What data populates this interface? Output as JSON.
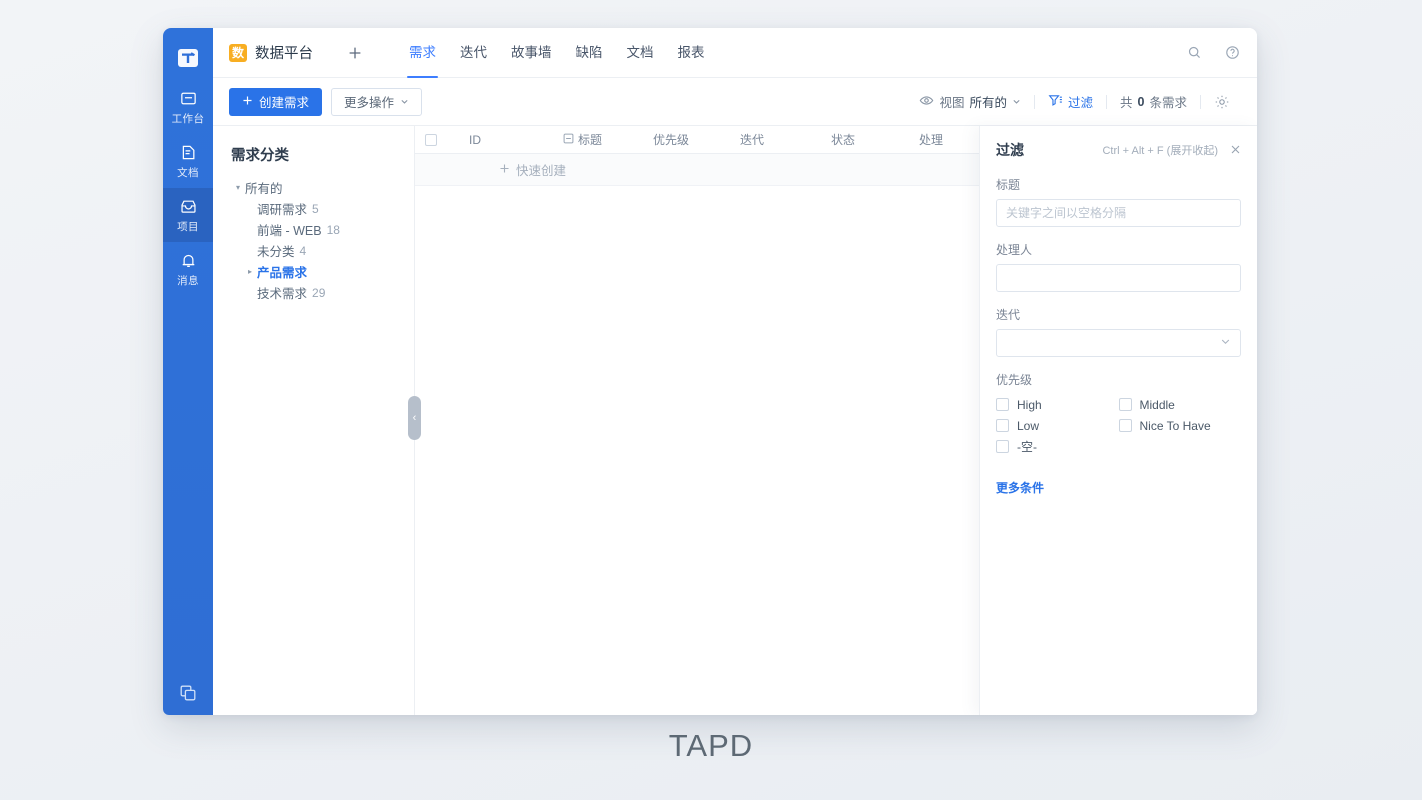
{
  "brand": {
    "accent": "#2a73e8",
    "rail_bg": "#2f6fd8",
    "badge_bg": "#f8ae22",
    "watermark": "TAPD"
  },
  "rail": {
    "logo_icon": "tapd-logo-icon",
    "items": [
      {
        "label": "工作台",
        "icon": "workbench-icon",
        "active": false
      },
      {
        "label": "文档",
        "icon": "document-icon",
        "active": false
      },
      {
        "label": "项目",
        "icon": "project-inbox-icon",
        "active": true
      },
      {
        "label": "消息",
        "icon": "bell-icon",
        "active": false
      }
    ],
    "bottom_icon": "windows-switch-icon"
  },
  "topbar": {
    "project_badge": "数",
    "project_name": "数据平台",
    "add_icon": "plus-icon",
    "tabs": [
      {
        "label": "需求",
        "active": true
      },
      {
        "label": "迭代",
        "active": false
      },
      {
        "label": "故事墙",
        "active": false
      },
      {
        "label": "缺陷",
        "active": false
      },
      {
        "label": "文档",
        "active": false
      },
      {
        "label": "报表",
        "active": false
      }
    ],
    "search_icon": "search-icon",
    "help_icon": "help-circle-icon"
  },
  "toolbar": {
    "create_label": "创建需求",
    "create_icon": "plus-icon",
    "more_actions_label": "更多操作",
    "more_actions_icon": "chevron-down-icon",
    "view_icon": "eye-icon",
    "view_label": "视图",
    "view_value": "所有的",
    "view_caret_icon": "chevron-down-icon",
    "filter_icon": "funnel-icon",
    "filter_label": "过滤",
    "count_prefix": "共",
    "count_value": "0",
    "count_suffix": "条需求",
    "settings_icon": "gear-icon"
  },
  "tree": {
    "title": "需求分类",
    "root": {
      "label": "所有的",
      "caret": "▾"
    },
    "items": [
      {
        "label": "调研需求",
        "count": "5",
        "selected": false,
        "caret": ""
      },
      {
        "label": "前端 - WEB",
        "count": "18",
        "selected": false,
        "caret": ""
      },
      {
        "label": "未分类",
        "count": "4",
        "selected": false,
        "caret": ""
      },
      {
        "label": "产品需求",
        "count": "",
        "selected": true,
        "caret": "▸"
      },
      {
        "label": "技术需求",
        "count": "29",
        "selected": false,
        "caret": ""
      }
    ]
  },
  "table": {
    "select_all_icon": "checkbox-icon",
    "columns": [
      {
        "label": "ID",
        "icon": ""
      },
      {
        "label": "标题",
        "icon": "collapse-box-icon"
      },
      {
        "label": "优先级",
        "icon": ""
      },
      {
        "label": "迭代",
        "icon": ""
      },
      {
        "label": "状态",
        "icon": ""
      },
      {
        "label": "处理",
        "icon": ""
      }
    ],
    "quick_create_icon": "plus-icon",
    "quick_create_label": "快速创建",
    "rows": []
  },
  "collapse_handle": {
    "icon": "chevron-left-icon",
    "glyph": "‹"
  },
  "filter_panel": {
    "title": "过滤",
    "shortcut_hint": "Ctrl + Alt + F (展开收起)",
    "close_icon": "close-icon",
    "fields": {
      "title": {
        "label": "标题",
        "placeholder": "关键字之间以空格分隔",
        "value": ""
      },
      "assignee": {
        "label": "处理人",
        "placeholder": "",
        "value": ""
      },
      "iteration": {
        "label": "迭代",
        "value": "",
        "caret_icon": "chevron-down-icon"
      }
    },
    "priority": {
      "label": "优先级",
      "options": [
        {
          "label": "High",
          "checked": false
        },
        {
          "label": "Middle",
          "checked": false
        },
        {
          "label": "Low",
          "checked": false
        },
        {
          "label": "Nice To Have",
          "checked": false
        },
        {
          "label": "-空-",
          "checked": false
        }
      ]
    },
    "more_conditions_label": "更多条件"
  }
}
